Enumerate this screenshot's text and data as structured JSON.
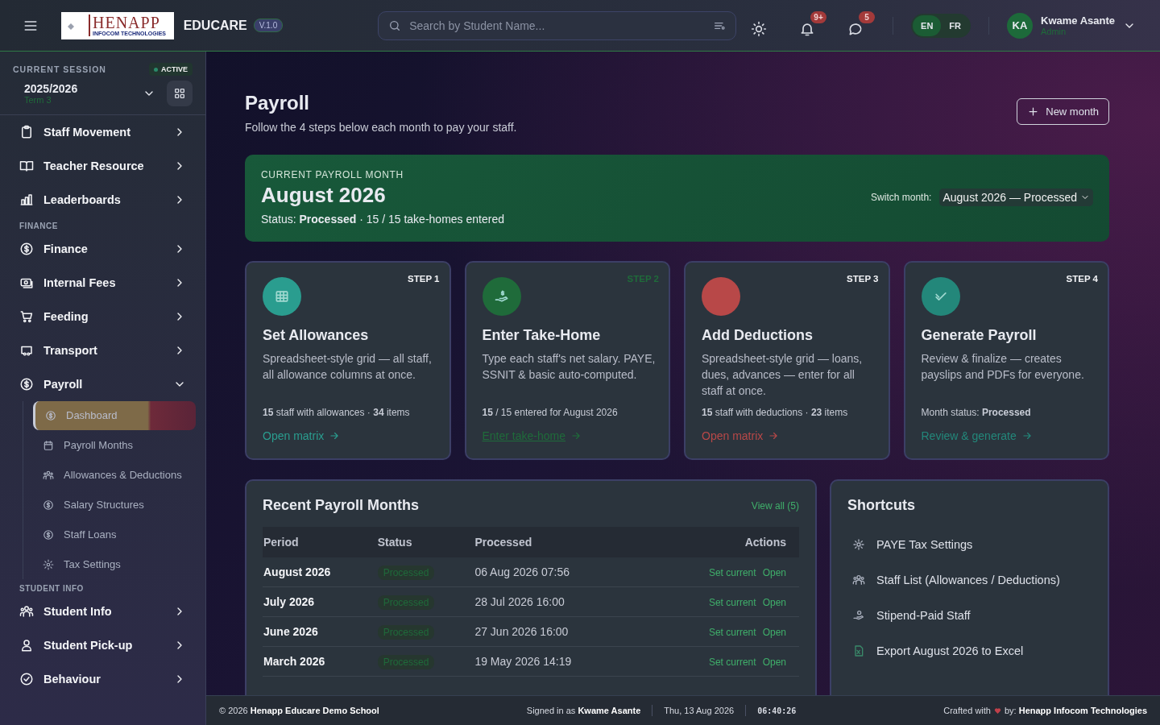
{
  "topbar": {
    "logo": {
      "name": "HENAPP",
      "tagline": "INFOCOM TECHNOLOGIES"
    },
    "app_name": "EDUCARE",
    "version": "V.1.0",
    "search": {
      "placeholder": "Search by Student Name..."
    },
    "notifications": "9+",
    "messages": "5",
    "languages": [
      {
        "label": "EN",
        "selected": true
      },
      {
        "label": "FR",
        "selected": false
      }
    ],
    "user": {
      "initials": "KA",
      "name": "Kwame Asante",
      "role": "Admin"
    }
  },
  "session": {
    "label": "CURRENT SESSION",
    "status": "ACTIVE",
    "year": "2025/2026",
    "term": "Term 3"
  },
  "sidebar": {
    "items": [
      {
        "kind": "item",
        "label": "Staff Movement",
        "expanded": false
      },
      {
        "kind": "item",
        "label": "Teacher Resource",
        "expanded": false
      },
      {
        "kind": "item",
        "label": "Leaderboards",
        "expanded": false
      },
      {
        "kind": "section",
        "label": "FINANCE"
      },
      {
        "kind": "item",
        "label": "Finance",
        "expanded": false
      },
      {
        "kind": "item",
        "label": "Internal Fees",
        "expanded": false
      },
      {
        "kind": "item",
        "label": "Feeding",
        "expanded": false
      },
      {
        "kind": "item",
        "label": "Transport",
        "expanded": false
      },
      {
        "kind": "item",
        "label": "Payroll",
        "expanded": true,
        "children": [
          {
            "label": "Dashboard",
            "selected": true
          },
          {
            "label": "Payroll Months",
            "selected": false
          },
          {
            "label": "Allowances & Deductions",
            "selected": false
          },
          {
            "label": "Salary Structures",
            "selected": false
          },
          {
            "label": "Staff Loans",
            "selected": false
          },
          {
            "label": "Tax Settings",
            "selected": false
          }
        ]
      },
      {
        "kind": "section",
        "label": "STUDENT INFO"
      },
      {
        "kind": "item",
        "label": "Student Info",
        "expanded": false
      },
      {
        "kind": "item",
        "label": "Student Pick-up",
        "expanded": false
      },
      {
        "kind": "item",
        "label": "Behaviour",
        "expanded": false
      }
    ]
  },
  "page": {
    "title": "Payroll",
    "subtitle": "Follow the 4 steps below each month to pay your staff.",
    "new_button": "New month"
  },
  "current_month": {
    "label": "CURRENT PAYROLL MONTH",
    "month": "August 2026",
    "status": "Status: **Processed** · 15 / 15 take-homes entered",
    "switch_label": "Switch month:",
    "switch_value": "August 2026 — Processed"
  },
  "steps": [
    {
      "step": "STEP 1",
      "title": "Set Allowances",
      "description": "Spreadsheet-style grid — all staff, all allowance columns at once.",
      "stats": "**15** staff with allowances · **34** items",
      "link": "Open matrix",
      "color": "#2a9d8f",
      "tinted_label": false
    },
    {
      "step": "STEP 2",
      "title": "Enter Take-Home",
      "description": "Type each staff's net salary. PAYE, SSNIT & basic auto-computed.",
      "stats": "**15** / 15 entered for August 2026",
      "link": "Enter take-home",
      "color": "#1f6b3a",
      "tinted_label": true
    },
    {
      "step": "STEP 3",
      "title": "Add Deductions",
      "description": "Spreadsheet-style grid — loans, dues, advances — enter for all staff at once.",
      "stats": "**15** staff with deductions · **23** items",
      "link": "Open matrix",
      "color": "#b84848",
      "tinted_label": false
    },
    {
      "step": "STEP 4",
      "title": "Generate Payroll",
      "description": "Review & finalize — creates payslips and PDFs for everyone.",
      "stats": "Month status: **Processed**",
      "link": "Review & generate",
      "color": "#23877a",
      "tinted_label": false
    }
  ],
  "recent": {
    "title": "Recent Payroll Months",
    "view_all": "View all (5)",
    "columns": [
      "Period",
      "Status",
      "Processed",
      "Actions"
    ],
    "rows": [
      {
        "period": "August 2026",
        "status": "Processed",
        "processed": "06 Aug 2026 07:56",
        "actions": [
          "Set current",
          "Open"
        ]
      },
      {
        "period": "July 2026",
        "status": "Processed",
        "processed": "28 Jul 2026 16:00",
        "actions": [
          "Set current",
          "Open"
        ]
      },
      {
        "period": "June 2026",
        "status": "Processed",
        "processed": "27 Jun 2026 16:00",
        "actions": [
          "Set current",
          "Open"
        ]
      },
      {
        "period": "March 2026",
        "status": "Processed",
        "processed": "19 May 2026 14:19",
        "actions": [
          "Set current",
          "Open"
        ]
      }
    ]
  },
  "shortcuts": {
    "title": "Shortcuts",
    "items": [
      "PAYE Tax Settings",
      "Staff List (Allowances / Deductions)",
      "Stipend-Paid Staff",
      "Export August 2026 to Excel"
    ]
  },
  "footer": {
    "copyright": "© 2026 **Henapp Educare Demo School**",
    "signed_in": "Signed in as **Kwame Asante**",
    "date": "Thu, 13 Aug 2026",
    "time": "06:40:26",
    "crafted": "Crafted with",
    "credit": "by: **Henapp Infocom Technologies**"
  }
}
